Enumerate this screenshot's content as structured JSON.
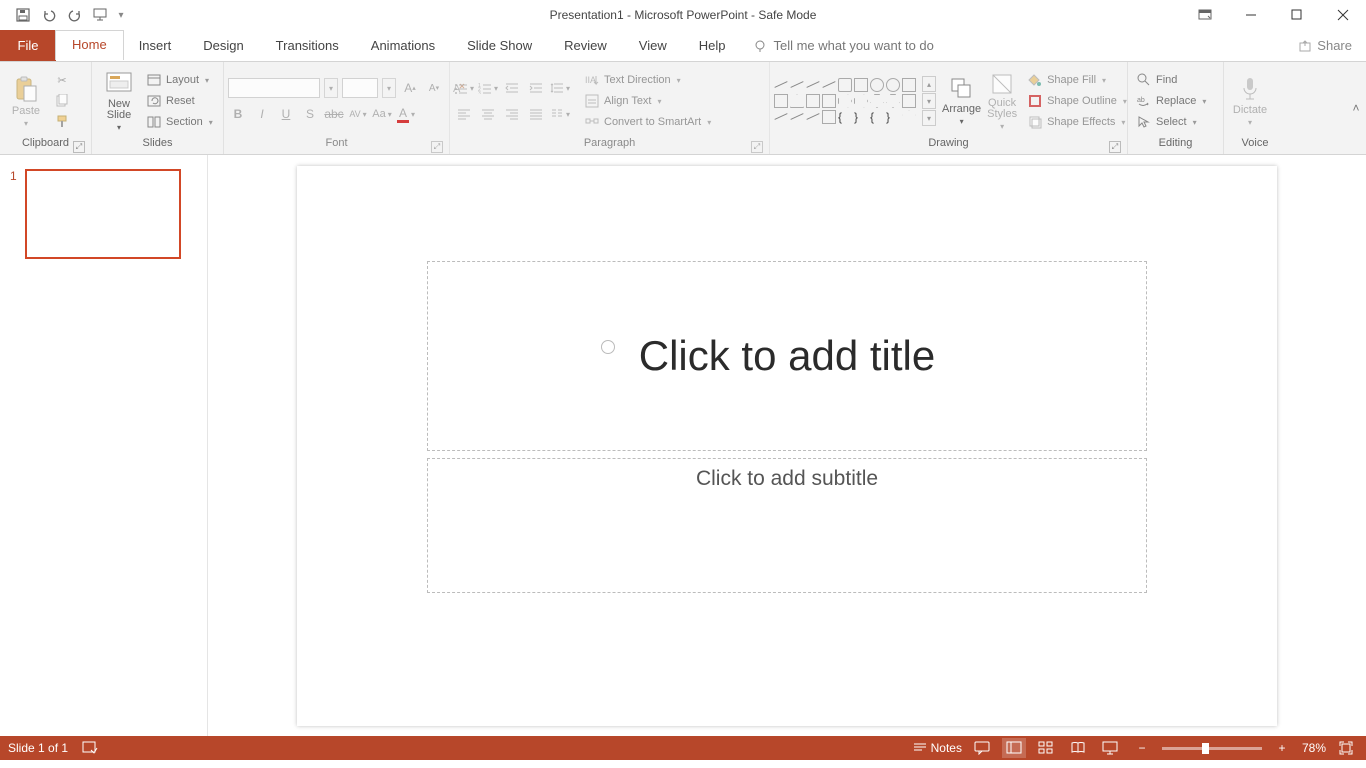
{
  "titlebar": {
    "title": "Presentation1  -  Microsoft PowerPoint  -  Safe Mode"
  },
  "tabs": {
    "file": "File",
    "items": [
      "Home",
      "Insert",
      "Design",
      "Transitions",
      "Animations",
      "Slide Show",
      "Review",
      "View",
      "Help"
    ],
    "active": "Home",
    "tellme_placeholder": "Tell me what you want to do",
    "share": "Share"
  },
  "ribbon": {
    "clipboard": {
      "label": "Clipboard",
      "paste": "Paste"
    },
    "slides": {
      "label": "Slides",
      "new": "New Slide",
      "layout": "Layout",
      "reset": "Reset",
      "section": "Section"
    },
    "font": {
      "label": "Font",
      "name": "",
      "size": ""
    },
    "paragraph": {
      "label": "Paragraph",
      "textdir": "Text Direction",
      "align": "Align Text",
      "smartart": "Convert to SmartArt"
    },
    "drawing": {
      "label": "Drawing",
      "arrange": "Arrange",
      "quick": "Quick Styles",
      "fill": "Shape Fill",
      "outline": "Shape Outline",
      "effects": "Shape Effects"
    },
    "editing": {
      "label": "Editing",
      "find": "Find",
      "replace": "Replace",
      "select": "Select"
    },
    "voice": {
      "label": "Voice",
      "dictate": "Dictate"
    }
  },
  "slide": {
    "title_placeholder": "Click to add title",
    "subtitle_placeholder": "Click to add subtitle"
  },
  "status": {
    "slide": "Slide 1 of 1",
    "notes": "Notes",
    "zoom": "78%"
  },
  "thumb": {
    "number": "1"
  }
}
